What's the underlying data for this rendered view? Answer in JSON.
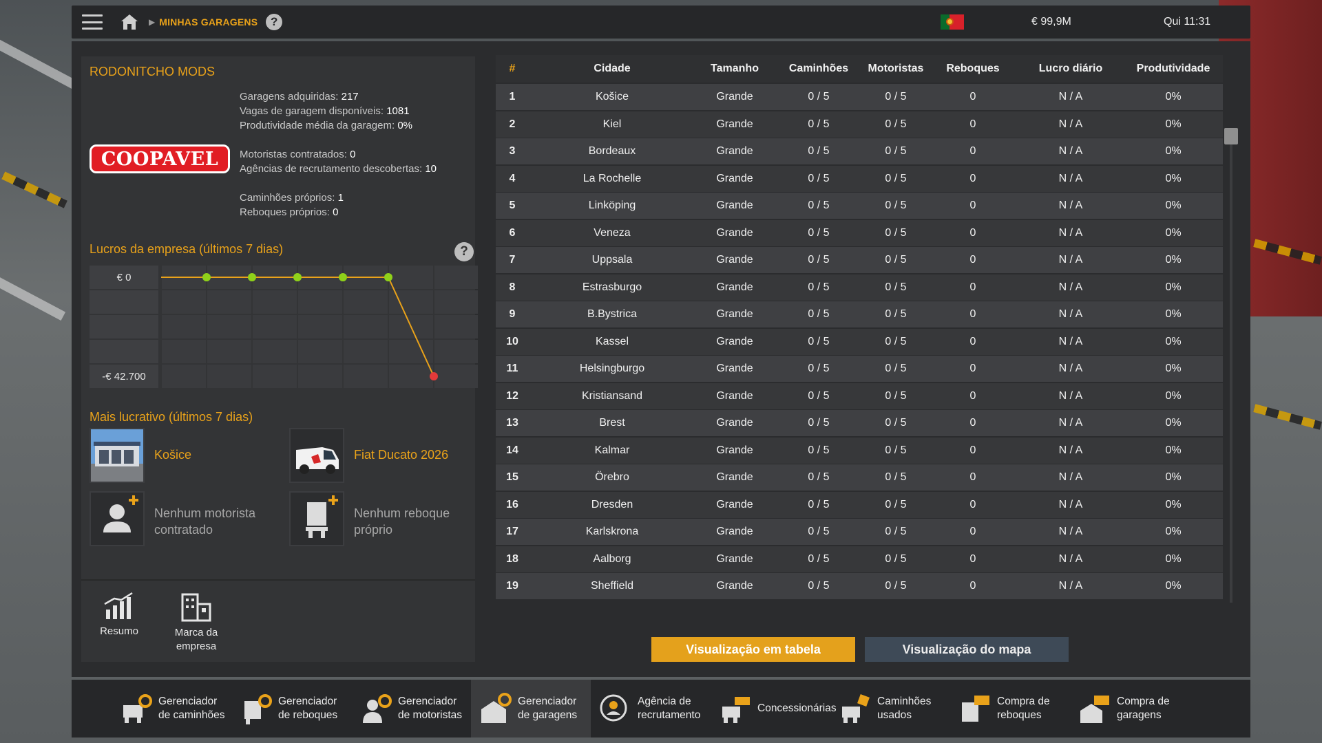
{
  "topbar": {
    "breadcrumb": "MINHAS GARAGENS",
    "help": "?",
    "money": "€ 99,9M",
    "clock": "Qui 11:31"
  },
  "company": {
    "name": "RODONITCHO MODS",
    "logo_text": "COOPAVEL",
    "stats": [
      {
        "label": "Garagens adquiridas:",
        "value": "217"
      },
      {
        "label": "Vagas de garagem disponíveis:",
        "value": "1081"
      },
      {
        "label": "Produtividade média da garagem:",
        "value": "0%"
      },
      {
        "label": "Motoristas contratados:",
        "value": "0"
      },
      {
        "label": "Agências de recrutamento descobertas:",
        "value": "10"
      },
      {
        "label": "Caminhões próprios:",
        "value": "1"
      },
      {
        "label": "Reboques próprios:",
        "value": "0"
      }
    ]
  },
  "profits": {
    "title": "Lucros da empresa (últimos 7 dias)",
    "help": "?",
    "label_top": "€ 0",
    "label_bottom": "-€ 42.700"
  },
  "chart_data": {
    "type": "line",
    "x": [
      1,
      2,
      3,
      4,
      5,
      6,
      7
    ],
    "values": [
      0,
      0,
      0,
      0,
      0,
      0,
      -42700
    ],
    "ylim": [
      -42700,
      0
    ],
    "colors": {
      "line": "#e9a21a",
      "point": "#8fd11a",
      "last_point": "#e23a3a"
    }
  },
  "most_profitable": {
    "title": "Mais lucrativo (últimos 7 dias)",
    "garage": "Košice",
    "truck": "Fiat Ducato 2026",
    "driver": "Nenhum motorista contratado",
    "trailer": "Nenhum reboque próprio"
  },
  "left_bottom": {
    "summary": "Resumo",
    "brand": "Marca da empresa"
  },
  "table": {
    "headers": [
      "#",
      "Cidade",
      "Tamanho",
      "Caminhões",
      "Motoristas",
      "Reboques",
      "Lucro diário",
      "Produtividade"
    ],
    "rows": [
      [
        "1",
        "Košice",
        "Grande",
        "0 / 5",
        "0 / 5",
        "0",
        "N / A",
        "0%"
      ],
      [
        "2",
        "Kiel",
        "Grande",
        "0 / 5",
        "0 / 5",
        "0",
        "N / A",
        "0%"
      ],
      [
        "3",
        "Bordeaux",
        "Grande",
        "0 / 5",
        "0 / 5",
        "0",
        "N / A",
        "0%"
      ],
      [
        "4",
        "La Rochelle",
        "Grande",
        "0 / 5",
        "0 / 5",
        "0",
        "N / A",
        "0%"
      ],
      [
        "5",
        "Linköping",
        "Grande",
        "0 / 5",
        "0 / 5",
        "0",
        "N / A",
        "0%"
      ],
      [
        "6",
        "Veneza",
        "Grande",
        "0 / 5",
        "0 / 5",
        "0",
        "N / A",
        "0%"
      ],
      [
        "7",
        "Uppsala",
        "Grande",
        "0 / 5",
        "0 / 5",
        "0",
        "N / A",
        "0%"
      ],
      [
        "8",
        "Estrasburgo",
        "Grande",
        "0 / 5",
        "0 / 5",
        "0",
        "N / A",
        "0%"
      ],
      [
        "9",
        "B.Bystrica",
        "Grande",
        "0 / 5",
        "0 / 5",
        "0",
        "N / A",
        "0%"
      ],
      [
        "10",
        "Kassel",
        "Grande",
        "0 / 5",
        "0 / 5",
        "0",
        "N / A",
        "0%"
      ],
      [
        "11",
        "Helsingburgo",
        "Grande",
        "0 / 5",
        "0 / 5",
        "0",
        "N / A",
        "0%"
      ],
      [
        "12",
        "Kristiansand",
        "Grande",
        "0 / 5",
        "0 / 5",
        "0",
        "N / A",
        "0%"
      ],
      [
        "13",
        "Brest",
        "Grande",
        "0 / 5",
        "0 / 5",
        "0",
        "N / A",
        "0%"
      ],
      [
        "14",
        "Kalmar",
        "Grande",
        "0 / 5",
        "0 / 5",
        "0",
        "N / A",
        "0%"
      ],
      [
        "15",
        "Örebro",
        "Grande",
        "0 / 5",
        "0 / 5",
        "0",
        "N / A",
        "0%"
      ],
      [
        "16",
        "Dresden",
        "Grande",
        "0 / 5",
        "0 / 5",
        "0",
        "N / A",
        "0%"
      ],
      [
        "17",
        "Karlskrona",
        "Grande",
        "0 / 5",
        "0 / 5",
        "0",
        "N / A",
        "0%"
      ],
      [
        "18",
        "Aalborg",
        "Grande",
        "0 / 5",
        "0 / 5",
        "0",
        "N / A",
        "0%"
      ],
      [
        "19",
        "Sheffield",
        "Grande",
        "0 / 5",
        "0 / 5",
        "0",
        "N / A",
        "0%"
      ]
    ]
  },
  "views": {
    "table": "Visualização em tabela",
    "map": "Visualização do mapa"
  },
  "nav": [
    {
      "label": "Gerenciador de caminhões",
      "icon": "truck-gear-icon"
    },
    {
      "label": "Gerenciador de reboques",
      "icon": "trailer-gear-icon"
    },
    {
      "label": "Gerenciador de motoristas",
      "icon": "driver-gear-icon"
    },
    {
      "label": "Gerenciador de garagens",
      "icon": "garage-gear-icon"
    },
    {
      "label": "Agência de recrutamento",
      "icon": "recruitment-icon"
    },
    {
      "label": "Concessionárias",
      "icon": "dealer-icon"
    },
    {
      "label": "Caminhões usados",
      "icon": "used-truck-icon"
    },
    {
      "label": "Compra de reboques",
      "icon": "buy-trailer-icon"
    },
    {
      "label": "Compra de garagens",
      "icon": "buy-garage-icon"
    }
  ]
}
